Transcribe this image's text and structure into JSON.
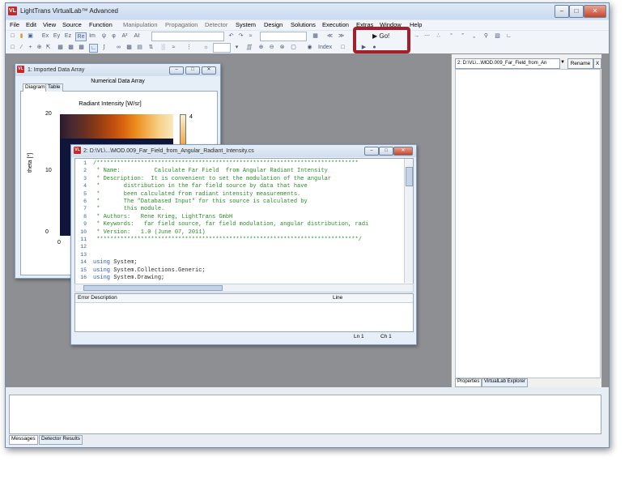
{
  "window": {
    "title": "LightTrans VirtualLab™ Advanced",
    "icon": "VL"
  },
  "menu": [
    "File",
    "Edit",
    "View",
    "Source",
    "Function",
    "Manipulation",
    "Propagation",
    "Detector",
    "System",
    "Design",
    "Solutions",
    "Execution",
    "Extras",
    "Window",
    "Help"
  ],
  "toolbar": {
    "go_label": "Go!",
    "index_label": "Index"
  },
  "array_window": {
    "title": "1: Imported Data Array",
    "subtitle": "Numerical Data Array",
    "tabs": [
      "Diagram",
      "Table"
    ],
    "plot_title": "Radiant Intensity  [W/sr]",
    "y_label": "theta [°]",
    "y_ticks": [
      "20",
      "10",
      "0"
    ],
    "x_tick": "0",
    "colorbar_tick": "4"
  },
  "code_window": {
    "title": "2: D:\\VL\\...\\MOD.009_Far_Field_from_Angular_Radiant_Intensity.cs",
    "lines": [
      {
        "n": "1",
        "t": "/*****************************************************************************",
        "c": "comment"
      },
      {
        "n": "2",
        "t": " * Name:          Calculate Far Field  from Angular Radiant Intensity",
        "c": "comment"
      },
      {
        "n": "3",
        "t": " * Description:  It is convenient to set the modulation of the angular",
        "c": "comment"
      },
      {
        "n": "4",
        "t": " *       distribution in the far field source by data that have",
        "c": "comment"
      },
      {
        "n": "5",
        "t": " *       been calculated from radiant intensity measurements.",
        "c": "comment"
      },
      {
        "n": "6",
        "t": " *       The \"Databased Input\" for this source is calculated by",
        "c": "comment"
      },
      {
        "n": "7",
        "t": " *       this module.",
        "c": "comment"
      },
      {
        "n": "8",
        "t": " * Authors:   Rene Krieg, LightTrans GmbH",
        "c": "comment"
      },
      {
        "n": "9",
        "t": " * Keywords:   far field source, far field modulation, angular distribution, radi",
        "c": "comment"
      },
      {
        "n": "10",
        "t": " * Version:   1.0 (June 07, 2011)",
        "c": "comment"
      },
      {
        "n": "11",
        "t": " *****************************************************************************/",
        "c": "comment"
      },
      {
        "n": "12",
        "t": "",
        "c": "plain"
      },
      {
        "n": "13",
        "t": "",
        "c": "plain"
      },
      {
        "n": "14",
        "t": "using System;",
        "c": "code"
      },
      {
        "n": "15",
        "t": "using System.Collections.Generic;",
        "c": "code"
      },
      {
        "n": "16",
        "t": "using System.Drawing;",
        "c": "code"
      }
    ],
    "error_header": "Error Description",
    "line_header": "Line",
    "status_ln": "Ln 1",
    "status_ch": "Ch 1"
  },
  "right_panel": {
    "combo_value": "2: D:\\VL\\...\\MOD.009_Far_Field_from_An",
    "rename_label": "Rename",
    "close_label": "X",
    "tabs": [
      "Properties",
      "VirtualLab Explorer"
    ]
  },
  "bottom_tabs": [
    "Messages",
    "Detector Results"
  ],
  "colors": {
    "highlight": "#a3202a",
    "workspace": "#8d8f92",
    "comment_green": "#2a8a2a",
    "keyword_blue": "#2b55b8"
  }
}
